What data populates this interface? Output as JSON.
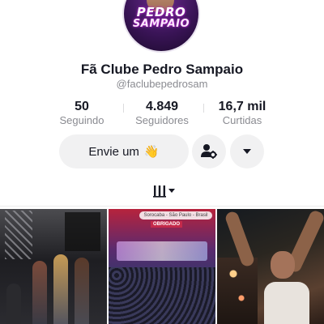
{
  "profile": {
    "logo_text_line1": "PEDRO",
    "logo_text_line2": "SAMPAIO",
    "display_name": "Fã Clube Pedro Sampaio",
    "username": "@faclubepedrosam"
  },
  "stats": [
    {
      "value": "50",
      "label": "Seguindo"
    },
    {
      "value": "4.849",
      "label": "Seguidores"
    },
    {
      "value": "16,7 mil",
      "label": "Curtidas"
    }
  ],
  "actions": {
    "message_label": "Envie um",
    "message_emoji": "👋",
    "add_friend_icon": "add-friend-gear-icon",
    "more_icon": "caret-down-icon"
  },
  "tabs": {
    "videos_icon": "video-grid-icon"
  },
  "videos": [
    {
      "overlay": "",
      "thumbnail": "dancers-on-stage"
    },
    {
      "overlay": "Sorocaba - São Paulo - Brasil",
      "badge": "OBRIGADO",
      "thumbnail": "concert-crowd"
    },
    {
      "overlay": "",
      "thumbnail": "fan-raising-arms"
    }
  ],
  "colors": {
    "text_primary": "#161823",
    "text_secondary": "#8a8b91",
    "button_bg": "#f1f1f2"
  }
}
